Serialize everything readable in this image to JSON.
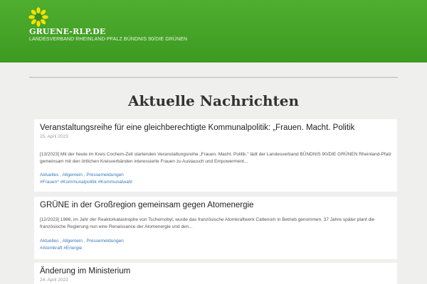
{
  "site": {
    "title": "GRUENE-RLP.DE",
    "description": "LANDESVERBAND RHEINLAND-PFALZ BÜNDNIS 90/DIE GRÜNEN"
  },
  "page": {
    "heading": "Aktuelle Nachrichten"
  },
  "posts": [
    {
      "title": "Veranstaltungsreihe für eine gleichberechtigte Kommunalpolitik: „Frauen. Macht. Politik",
      "date": "25. April 2023",
      "excerpt": "[13/2023] Mit der heute im Kreis Cochem-Zell startenden Veranstaltungsreihe „Frauen. Macht. Politik.\" lädt der Landesverband BÜNDNIS 90/DIE GRÜNEN Rheinland-Pfalz gemeinsam mit den örtlichen Kreisverbänden interessierte Frauen zu Austausch und Empowerment...",
      "categories": [
        "Aktuelles",
        "Allgemein",
        "Pressemeldungen"
      ],
      "tags": [
        "#Frauen*",
        "#Kommunalpolitik",
        "#Kommunalwahl"
      ]
    },
    {
      "title": "GRÜNE in der Großregion gemeinsam gegen Atomenergie",
      "date": "",
      "excerpt": "[12/2023] 1986, im Jahr der Reaktorkatastrophe von Tschernobyl, wurde das französische Atomkraftwerk Cattenom in Betrieb genommen. 37 Jahre später plant die französische Regierung nun eine Renaissance der Atomenergie und den...",
      "categories": [
        "Aktuelles",
        "Allgemein",
        "Pressemeldungen"
      ],
      "tags": [
        "#Atomkraft",
        "#Energie"
      ]
    },
    {
      "title": "Änderung im Ministerium",
      "date": "24. April 2023",
      "excerpt": "",
      "categories": [],
      "tags": []
    }
  ],
  "colors": {
    "header_green": "#46a428",
    "link_blue": "#3a7ab8",
    "background": "#efefed"
  },
  "icons": {
    "logo": "sunflower-logo-icon"
  }
}
